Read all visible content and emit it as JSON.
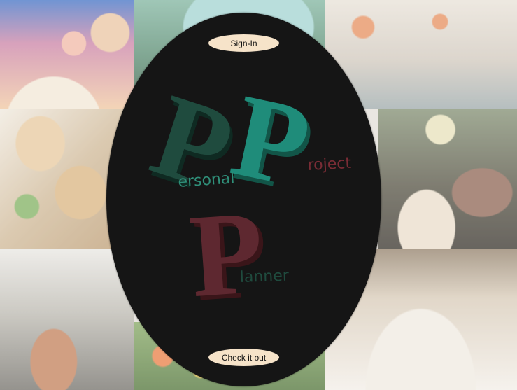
{
  "background": {
    "photos": [
      "birthday-party-photo",
      "vintage-van-photo",
      "restaurant-interior-photo",
      "sandwich-platter-photo",
      "birthday-cake-celebration-photo",
      "industrial-kitchen-photo",
      "tulip-field-photo",
      "banquet-hall-photo"
    ]
  },
  "logo": {
    "letters": [
      "P",
      "P",
      "P"
    ],
    "words": [
      "ersonal",
      "roject",
      "lanner"
    ],
    "colors": {
      "personal": "#1f4b3e",
      "project": "#1f8c7a",
      "planner": "#5e2830",
      "oval": "#151515",
      "button_fill": "#f6e3c9"
    }
  },
  "buttons": {
    "signin_label": "Sign-In",
    "checkit_label": "Check it out"
  }
}
